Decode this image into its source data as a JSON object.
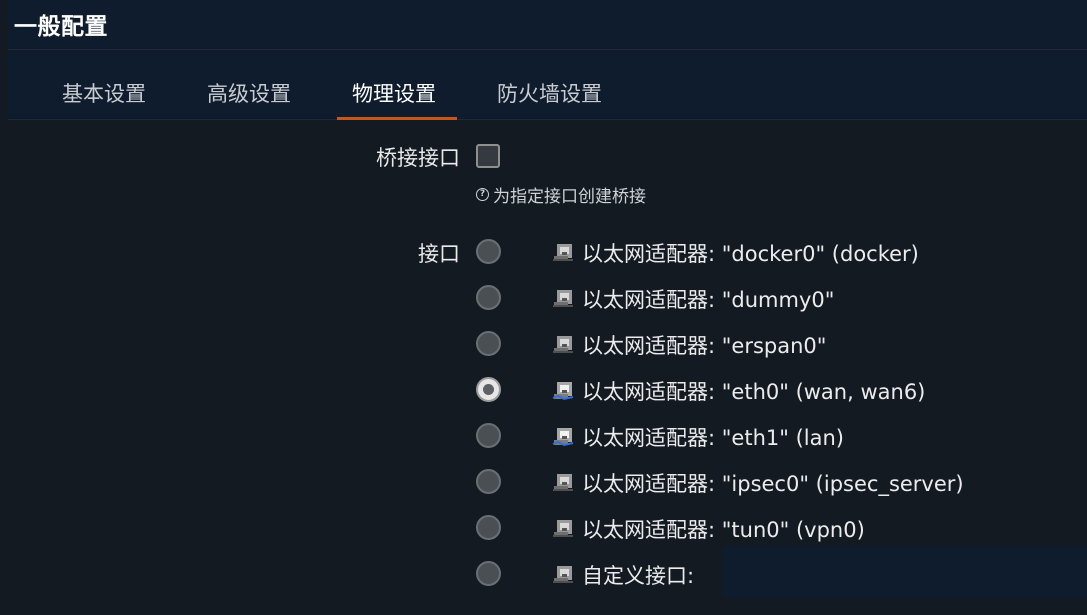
{
  "page": {
    "title": "一般配置"
  },
  "tabs": [
    {
      "label": "基本设置",
      "active": false
    },
    {
      "label": "高级设置",
      "active": false
    },
    {
      "label": "物理设置",
      "active": true
    },
    {
      "label": "防火墙设置",
      "active": false
    }
  ],
  "bridge": {
    "label": "桥接接口",
    "checked": false,
    "help_text": "为指定接口创建桥接",
    "help_icon": "question-circle-icon"
  },
  "interfaces": {
    "label": "接口",
    "options": [
      {
        "text": "以太网适配器: \"docker0\" (docker)",
        "selected": false,
        "icon": "ethernet-port-icon",
        "up": false
      },
      {
        "text": "以太网适配器: \"dummy0\"",
        "selected": false,
        "icon": "ethernet-port-icon",
        "up": false
      },
      {
        "text": "以太网适配器: \"erspan0\"",
        "selected": false,
        "icon": "ethernet-port-icon",
        "up": false
      },
      {
        "text": "以太网适配器: \"eth0\" (wan, wan6)",
        "selected": true,
        "icon": "ethernet-port-icon",
        "up": true
      },
      {
        "text": "以太网适配器: \"eth1\" (lan)",
        "selected": false,
        "icon": "ethernet-port-icon",
        "up": true
      },
      {
        "text": "以太网适配器: \"ipsec0\" (ipsec_server)",
        "selected": false,
        "icon": "ethernet-port-icon",
        "up": false
      },
      {
        "text": "以太网适配器: \"tun0\" (vpn0)",
        "selected": false,
        "icon": "ethernet-port-icon",
        "up": false
      },
      {
        "text": "自定义接口:",
        "selected": false,
        "icon": "ethernet-port-icon",
        "up": false
      }
    ],
    "custom_value": ""
  },
  "colors": {
    "background": "#131a22",
    "panel": "#0f1c2d",
    "accent": "#c5561d"
  }
}
